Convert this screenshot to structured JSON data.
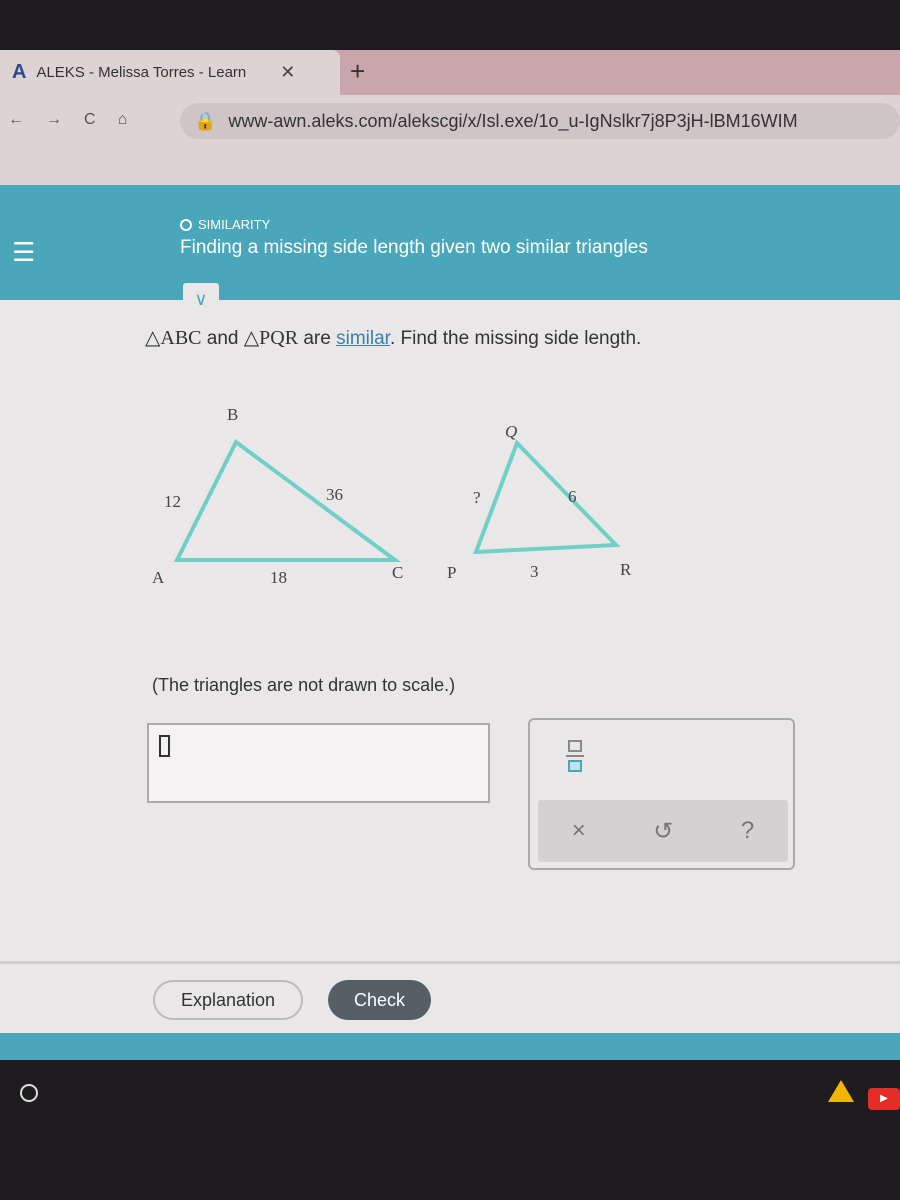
{
  "browser": {
    "tab_title": "ALEKS - Melissa Torres - Learn",
    "tab_logo": "A",
    "url": "www-awn.aleks.com/alekscgi/x/Isl.exe/1o_u-IgNslkr7j8P3jH-lBM16WIM"
  },
  "header": {
    "topic": "SIMILARITY",
    "title": "Finding a missing side length given two similar triangles"
  },
  "question": {
    "tri1": "△ABC",
    "and": " and ",
    "tri2": "△PQR",
    "are": " are ",
    "link": "similar",
    "rest": ". Find the missing side length."
  },
  "figure": {
    "abc": {
      "A": "A",
      "B": "B",
      "C": "C",
      "AB": "12",
      "BC": "36",
      "AC": "18"
    },
    "pqr": {
      "P": "P",
      "Q": "Q",
      "R": "R",
      "PQ": "?",
      "QR": "6",
      "PR": "3"
    }
  },
  "note": "(The triangles are not drawn to scale.)",
  "answer": {
    "value": ""
  },
  "buttons": {
    "explanation": "Explanation",
    "check": "Check",
    "clear": "×",
    "undo": "↺",
    "help": "?"
  },
  "colors": {
    "accent": "#4aa7bb",
    "check_button": "#556066",
    "triangle": "#6fd0c8"
  }
}
